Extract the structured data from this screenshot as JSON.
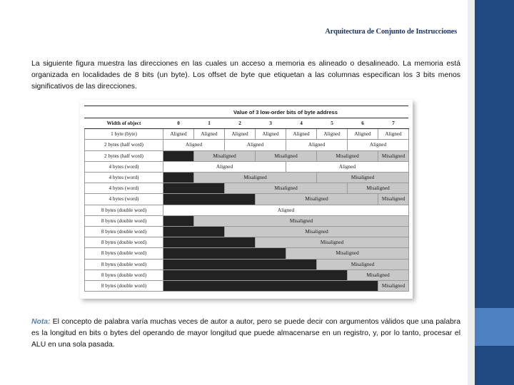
{
  "slide": {
    "title": "Arquitectura de Conjunto de Instrucciones"
  },
  "intro": {
    "text": "La siguiente figura muestra las direcciones en las cuales un acceso a memoria es alineado o desalineado. La memoria está organizada en localidades de 8 bits (un byte). Los offset de byte que etiquetan a las columnas especifican los 3 bits menos significativos de las direcciones."
  },
  "note": {
    "lead": "Nota:",
    "text": " El concepto de palabra varía muchas veces de autor a autor, pero se puede decir con argumentos válidos que una palabra es la longitud en bits o bytes del operando de mayor longitud que puede almacenarse en un registro, y, por lo tanto, procesar el ALU en una sola pasada."
  },
  "figure": {
    "super_header": "Value of 3 low-order bits of byte address",
    "label_header": "Width of object",
    "column_headers": [
      "0",
      "1",
      "2",
      "3",
      "4",
      "5",
      "6",
      "7"
    ],
    "labels": {
      "byte": "1 byte (byte)",
      "halfword": "2 bytes (half word)",
      "word": "4 bytes (word)",
      "doubleword": "8 bytes (double word)"
    },
    "cell_text": {
      "aligned": "Aligned",
      "misaligned": "Misaligned"
    },
    "colors": {
      "aligned_bg": "#ffffff",
      "misaligned_bg": "#c8c8c8",
      "pad_bg": "#222222",
      "grid": "#9a9a9a"
    },
    "rows": [
      {
        "label": "1 byte (byte)",
        "cells": [
          {
            "span": 1,
            "kind": "aligned",
            "text": "Aligned"
          },
          {
            "span": 1,
            "kind": "aligned",
            "text": "Aligned"
          },
          {
            "span": 1,
            "kind": "aligned",
            "text": "Aligned"
          },
          {
            "span": 1,
            "kind": "aligned",
            "text": "Aligned"
          },
          {
            "span": 1,
            "kind": "aligned",
            "text": "Aligned"
          },
          {
            "span": 1,
            "kind": "aligned",
            "text": "Aligned"
          },
          {
            "span": 1,
            "kind": "aligned",
            "text": "Aligned"
          },
          {
            "span": 1,
            "kind": "aligned",
            "text": "Aligned"
          }
        ]
      },
      {
        "label": "2 bytes (half word)",
        "cells": [
          {
            "span": 2,
            "kind": "aligned",
            "text": "Aligned"
          },
          {
            "span": 2,
            "kind": "aligned",
            "text": "Aligned"
          },
          {
            "span": 2,
            "kind": "aligned",
            "text": "Aligned"
          },
          {
            "span": 2,
            "kind": "aligned",
            "text": "Aligned"
          }
        ]
      },
      {
        "label": "2 bytes (half word)",
        "cells": [
          {
            "span": 1,
            "kind": "pad",
            "text": ""
          },
          {
            "span": 2,
            "kind": "misaligned",
            "text": "Misaligned"
          },
          {
            "span": 2,
            "kind": "misaligned",
            "text": "Misaligned"
          },
          {
            "span": 2,
            "kind": "misaligned",
            "text": "Misaligned"
          },
          {
            "span": 1,
            "kind": "misaligned",
            "text": "Misaligned"
          }
        ]
      },
      {
        "label": "4 bytes (word)",
        "cells": [
          {
            "span": 4,
            "kind": "aligned",
            "text": "Aligned"
          },
          {
            "span": 4,
            "kind": "aligned",
            "text": "Aligned"
          }
        ]
      },
      {
        "label": "4 bytes (word)",
        "cells": [
          {
            "span": 1,
            "kind": "pad",
            "text": ""
          },
          {
            "span": 4,
            "kind": "misaligned",
            "text": "Misaligned"
          },
          {
            "span": 3,
            "kind": "misaligned",
            "text": "Misaligned"
          }
        ]
      },
      {
        "label": "4 bytes (word)",
        "cells": [
          {
            "span": 2,
            "kind": "pad",
            "text": ""
          },
          {
            "span": 4,
            "kind": "misaligned",
            "text": "Misaligned"
          },
          {
            "span": 2,
            "kind": "misaligned",
            "text": "Misaligned"
          }
        ]
      },
      {
        "label": "4 bytes (word)",
        "cells": [
          {
            "span": 3,
            "kind": "pad",
            "text": ""
          },
          {
            "span": 4,
            "kind": "misaligned",
            "text": "Misaligned"
          },
          {
            "span": 1,
            "kind": "misaligned",
            "text": "Misaligned"
          }
        ]
      },
      {
        "label": "8 bytes (double word)",
        "cells": [
          {
            "span": 8,
            "kind": "aligned",
            "text": "Aligned"
          }
        ]
      },
      {
        "label": "8 bytes (double word)",
        "cells": [
          {
            "span": 1,
            "kind": "pad",
            "text": ""
          },
          {
            "span": 7,
            "kind": "misaligned",
            "text": "Misaligned"
          }
        ]
      },
      {
        "label": "8 bytes (double word)",
        "cells": [
          {
            "span": 2,
            "kind": "pad",
            "text": ""
          },
          {
            "span": 6,
            "kind": "misaligned",
            "text": "Misaligned"
          }
        ]
      },
      {
        "label": "8 bytes (double word)",
        "cells": [
          {
            "span": 3,
            "kind": "pad",
            "text": ""
          },
          {
            "span": 5,
            "kind": "misaligned",
            "text": "Misaligned"
          }
        ]
      },
      {
        "label": "8 bytes (double word)",
        "cells": [
          {
            "span": 4,
            "kind": "pad",
            "text": ""
          },
          {
            "span": 4,
            "kind": "misaligned",
            "text": "Misaligned"
          }
        ]
      },
      {
        "label": "8 bytes (double word)",
        "cells": [
          {
            "span": 5,
            "kind": "pad",
            "text": ""
          },
          {
            "span": 3,
            "kind": "misaligned",
            "text": "Misaligned"
          }
        ]
      },
      {
        "label": "8 bytes (double word)",
        "cells": [
          {
            "span": 6,
            "kind": "pad",
            "text": ""
          },
          {
            "span": 2,
            "kind": "misaligned",
            "text": "Misaligned"
          }
        ]
      },
      {
        "label": "8 bytes (double word)",
        "cells": [
          {
            "span": 7,
            "kind": "pad",
            "text": ""
          },
          {
            "span": 1,
            "kind": "misaligned",
            "text": "Misaligned"
          }
        ]
      }
    ]
  },
  "theme": {
    "rail": "#1f4a80",
    "rail_accent": "#4e81bf",
    "title_color": "#1f3864",
    "note_lead_color": "#5b7fa6"
  }
}
